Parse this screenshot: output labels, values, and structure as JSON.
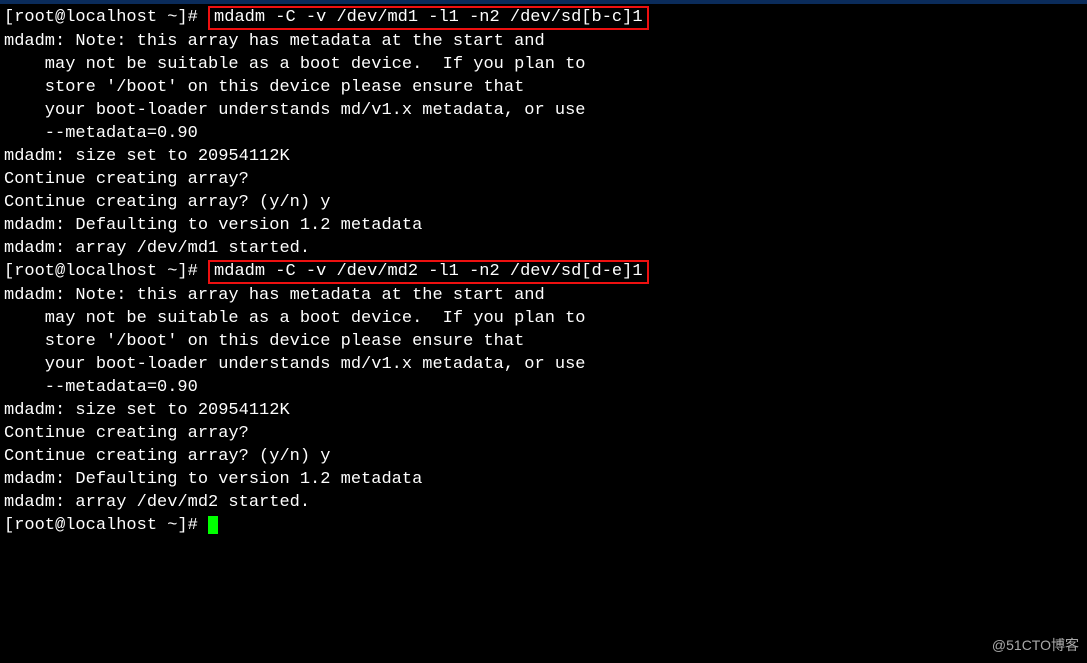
{
  "prompt1": "[root@localhost ~]# ",
  "cmd1": "mdadm -C -v /dev/md1 -l1 -n2 /dev/sd[b-c]1",
  "block1": [
    "mdadm: Note: this array has metadata at the start and",
    "    may not be suitable as a boot device.  If you plan to",
    "    store '/boot' on this device please ensure that",
    "    your boot-loader understands md/v1.x metadata, or use",
    "    --metadata=0.90",
    "mdadm: size set to 20954112K",
    "Continue creating array?",
    "Continue creating array? (y/n) y",
    "mdadm: Defaulting to version 1.2 metadata",
    "mdadm: array /dev/md1 started."
  ],
  "prompt2": "[root@localhost ~]# ",
  "cmd2": "mdadm -C -v /dev/md2 -l1 -n2 /dev/sd[d-e]1",
  "block2": [
    "mdadm: Note: this array has metadata at the start and",
    "    may not be suitable as a boot device.  If you plan to",
    "    store '/boot' on this device please ensure that",
    "    your boot-loader understands md/v1.x metadata, or use",
    "    --metadata=0.90",
    "mdadm: size set to 20954112K",
    "Continue creating array?",
    "Continue creating array? (y/n) y",
    "mdadm: Defaulting to version 1.2 metadata",
    "mdadm: array /dev/md2 started."
  ],
  "prompt3": "[root@localhost ~]# ",
  "watermark": "@51CTO博客"
}
